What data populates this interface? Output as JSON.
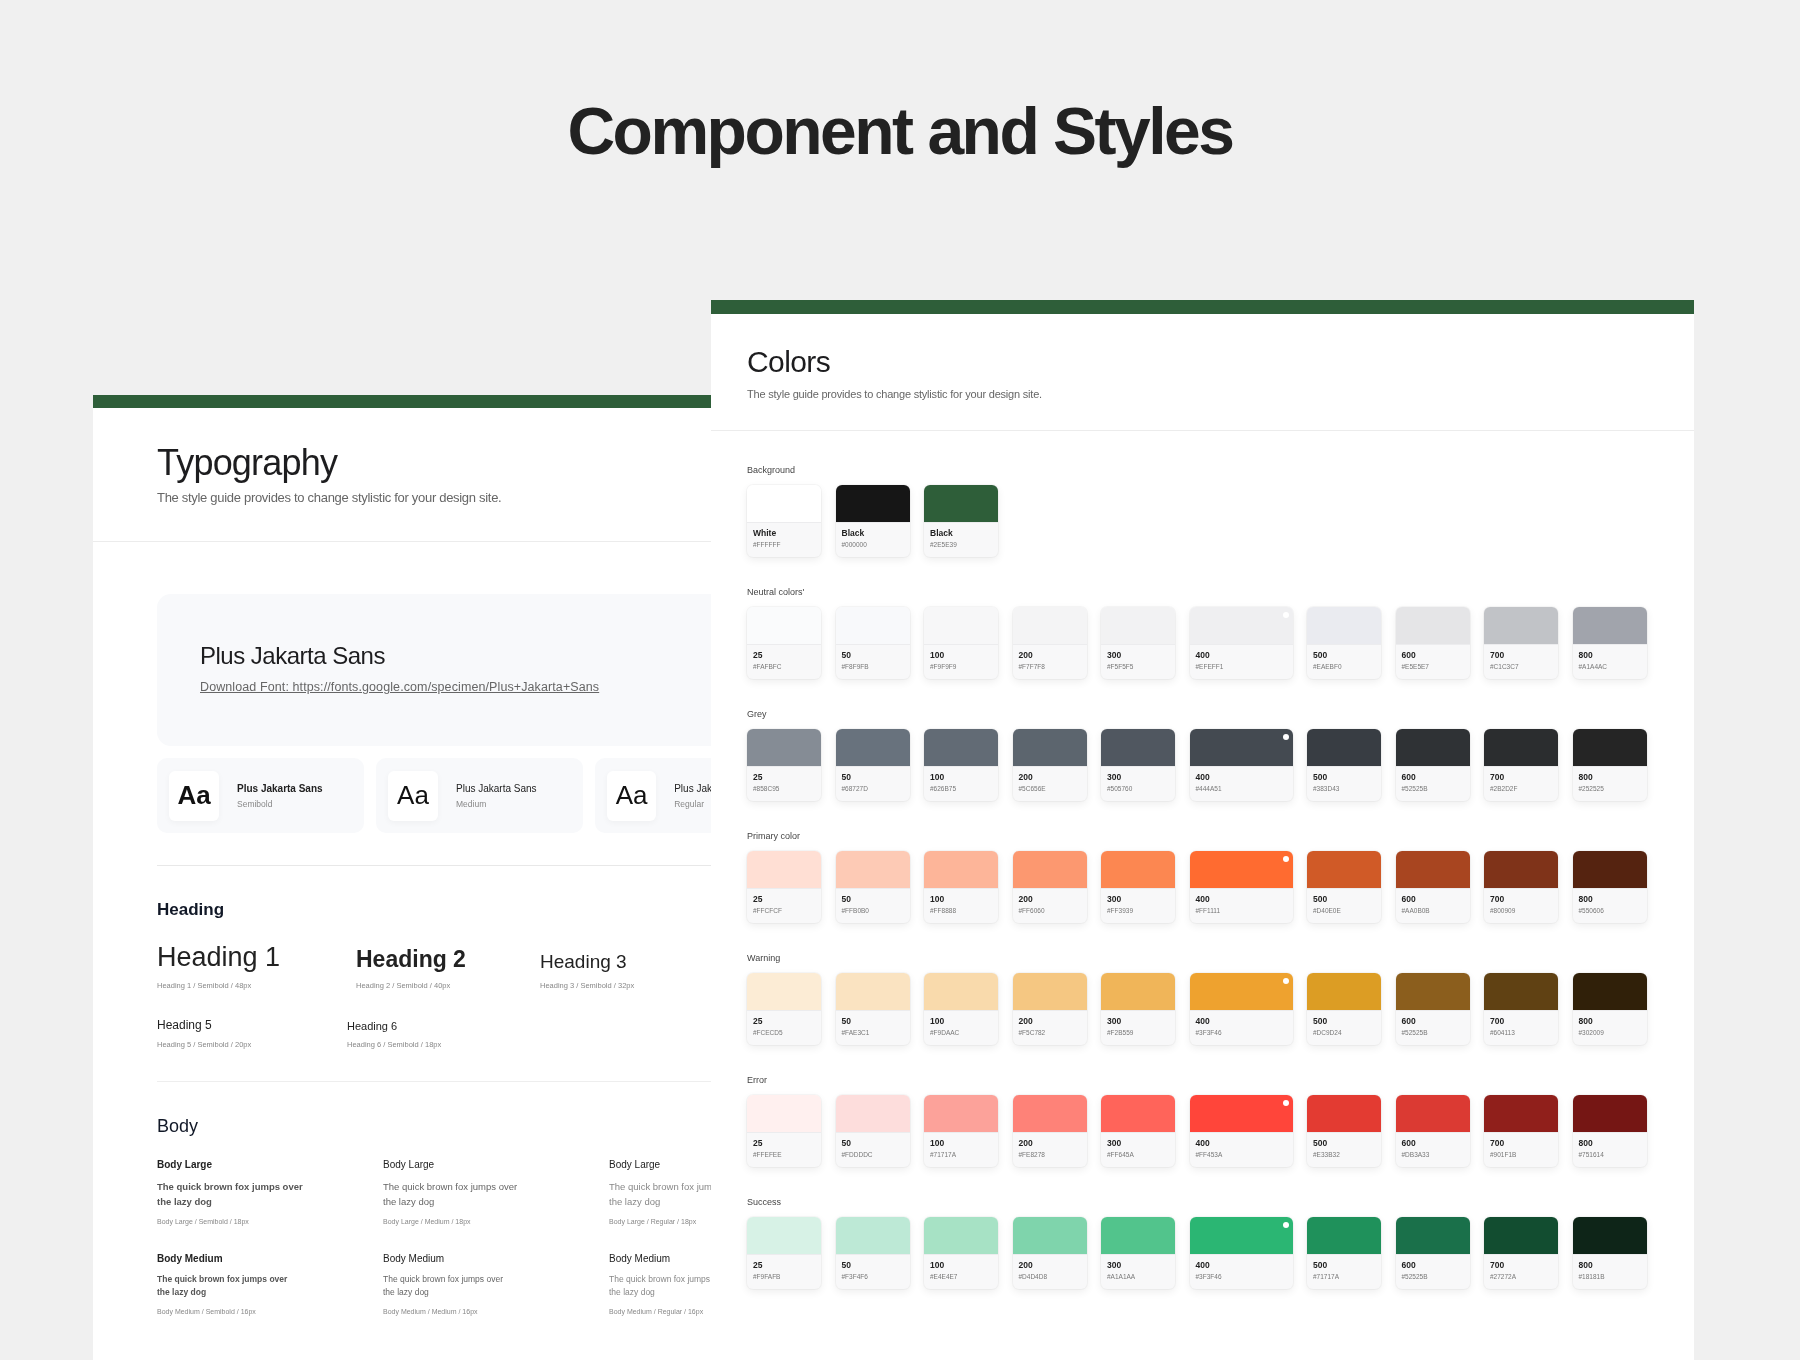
{
  "title": "Component and Styles",
  "typography": {
    "title": "Typography",
    "subtitle": "The style guide provides to change stylistic for your design site.",
    "font_card": {
      "name": "Plus Jakarta Sans",
      "link": "Download Font: https://fonts.google.com/specimen/Plus+Jakarta+Sans"
    },
    "weights": [
      {
        "sample": "Aa",
        "name": "Plus Jakarta Sans",
        "kind": "semibold",
        "caption": "Semibold"
      },
      {
        "sample": "Aa",
        "name": "Plus Jakarta Sans",
        "kind": "medium",
        "caption": "Medium"
      },
      {
        "sample": "Aa",
        "name": "Plus Jak",
        "kind": "regular",
        "caption": "Regular"
      }
    ],
    "headings": {
      "title": "Heading",
      "rows": [
        {
          "items": [
            {
              "kind": "h1",
              "text": "Heading 1",
              "caption": "Heading 1 / Semibold / 48px"
            },
            {
              "kind": "h2",
              "text": "Heading 2",
              "caption": "Heading 2 / Semibold / 40px"
            },
            {
              "kind": "h3",
              "text": "Heading 3",
              "caption": "Heading 3 / Semibold / 32px"
            }
          ]
        },
        {
          "items": [
            {
              "kind": "h5",
              "text": "Heading 5",
              "caption": "Heading 5 / Semibold / 20px"
            },
            {
              "kind": "h6",
              "text": "Heading 6",
              "caption": "Heading 6 / Semibold / 18px"
            }
          ]
        }
      ]
    },
    "body": {
      "title": "Body",
      "rows": [
        {
          "kind": "large",
          "items": [
            {
              "label": "Body Large",
              "kind": "semibold",
              "lines": [
                "The quick brown fox jumps over",
                "the lazy dog"
              ],
              "caption": "Body Large / Semibold / 18px"
            },
            {
              "label": "Body Large",
              "kind": "medium",
              "lines": [
                "The quick brown fox jumps over",
                "the lazy dog"
              ],
              "caption": "Body Large / Medium / 18px"
            },
            {
              "label": "Body Large",
              "kind": "regular",
              "lines": [
                "The quick brown fox jum",
                "the lazy dog"
              ],
              "caption": "Body Large / Regular / 18px"
            }
          ]
        },
        {
          "kind": "medium",
          "items": [
            {
              "label": "Body Medium",
              "kind": "semibold",
              "lines": [
                "The quick brown fox jumps over",
                "the lazy dog"
              ],
              "caption": "Body Medium / Semibold / 16px"
            },
            {
              "label": "Body Medium",
              "kind": "medium",
              "lines": [
                "The quick brown fox jumps over",
                "the lazy dog"
              ],
              "caption": "Body Medium / Medium / 16px"
            },
            {
              "label": "Body Medium",
              "kind": "regular",
              "lines": [
                "The quick brown fox jumps",
                "the lazy dog"
              ],
              "caption": "Body Medium / Regular / 16px"
            }
          ]
        }
      ]
    }
  },
  "colors": {
    "title": "Colors",
    "subtitle": "The style guide provides to change stylistic for your design site.",
    "groups": [
      {
        "label": "Background",
        "swatches": [
          {
            "label": "White",
            "hex": "#FFFFFF",
            "color": "#ffffff",
            "selected": false
          },
          {
            "label": "Black",
            "hex": "#000000",
            "color": "#161616",
            "selected": false
          },
          {
            "label": "Black",
            "hex": "#2E5E39",
            "color": "#2e5e39",
            "selected": false
          }
        ]
      },
      {
        "label": "Neutral colors'",
        "swatches": [
          {
            "label": "25",
            "hex": "#FAFBFC",
            "color": "#fafbfc",
            "selected": false
          },
          {
            "label": "50",
            "hex": "#F8F9FB",
            "color": "#f8f9fb",
            "selected": false
          },
          {
            "label": "100",
            "hex": "#F9F9F9",
            "color": "#f7f7f8",
            "selected": false
          },
          {
            "label": "200",
            "hex": "#F7F7F8",
            "color": "#f4f4f5",
            "selected": false
          },
          {
            "label": "300",
            "hex": "#F5F5F5",
            "color": "#f2f2f3",
            "selected": false
          },
          {
            "label": "400",
            "hex": "#EFEFF1",
            "color": "#efeff1",
            "selected": true
          },
          {
            "label": "500",
            "hex": "#EAEBF0",
            "color": "#eaebf0",
            "selected": false
          },
          {
            "label": "600",
            "hex": "#E5E5E7",
            "color": "#e5e5e7",
            "selected": false
          },
          {
            "label": "700",
            "hex": "#C1C3C7",
            "color": "#c1c3c7",
            "selected": false
          },
          {
            "label": "800",
            "hex": "#A1A4AC",
            "color": "#a1a4ac",
            "selected": false
          }
        ]
      },
      {
        "label": "Grey",
        "swatches": [
          {
            "label": "25",
            "hex": "#858C95",
            "color": "#858c95",
            "selected": false
          },
          {
            "label": "50",
            "hex": "#68727D",
            "color": "#68727d",
            "selected": false
          },
          {
            "label": "100",
            "hex": "#626B75",
            "color": "#626b75",
            "selected": false
          },
          {
            "label": "200",
            "hex": "#5C656E",
            "color": "#5c656e",
            "selected": false
          },
          {
            "label": "300",
            "hex": "#505760",
            "color": "#505760",
            "selected": false
          },
          {
            "label": "400",
            "hex": "#444A51",
            "color": "#444a51",
            "selected": true
          },
          {
            "label": "500",
            "hex": "#383D43",
            "color": "#383d43",
            "selected": false
          },
          {
            "label": "600",
            "hex": "#52525B",
            "color": "#2f3235",
            "selected": false
          },
          {
            "label": "700",
            "hex": "#2B2D2F",
            "color": "#2b2d2f",
            "selected": false
          },
          {
            "label": "800",
            "hex": "#252525",
            "color": "#252525",
            "selected": false
          }
        ]
      },
      {
        "label": "Primary color",
        "swatches": [
          {
            "label": "25",
            "hex": "#FFCFCF",
            "color": "#ffdfd4",
            "selected": false
          },
          {
            "label": "50",
            "hex": "#FFB0B0",
            "color": "#fdcab5",
            "selected": false
          },
          {
            "label": "100",
            "hex": "#FF8888",
            "color": "#fdb599",
            "selected": false
          },
          {
            "label": "200",
            "hex": "#FF6060",
            "color": "#fc9870",
            "selected": false
          },
          {
            "label": "300",
            "hex": "#FF3939",
            "color": "#fc8751",
            "selected": false
          },
          {
            "label": "400",
            "hex": "#FF1111",
            "color": "#ff6b30",
            "selected": true
          },
          {
            "label": "500",
            "hex": "#D40E0E",
            "color": "#d05a27",
            "selected": false
          },
          {
            "label": "600",
            "hex": "#AA0B0B",
            "color": "#a84520",
            "selected": false
          },
          {
            "label": "700",
            "hex": "#800909",
            "color": "#7f3319",
            "selected": false
          },
          {
            "label": "800",
            "hex": "#550606",
            "color": "#552310",
            "selected": false
          }
        ]
      },
      {
        "label": "Warning",
        "swatches": [
          {
            "label": "25",
            "hex": "#FCECD5",
            "color": "#fcecd5",
            "selected": false
          },
          {
            "label": "50",
            "hex": "#FAE3C1",
            "color": "#fae3c1",
            "selected": false
          },
          {
            "label": "100",
            "hex": "#F9DAAC",
            "color": "#f9daac",
            "selected": false
          },
          {
            "label": "200",
            "hex": "#F5C782",
            "color": "#f5c782",
            "selected": false
          },
          {
            "label": "300",
            "hex": "#F2B559",
            "color": "#f0b559",
            "selected": false
          },
          {
            "label": "400",
            "hex": "#3F3F46",
            "color": "#eea22f",
            "selected": true
          },
          {
            "label": "500",
            "hex": "#DC9D24",
            "color": "#dc9d24",
            "selected": false
          },
          {
            "label": "600",
            "hex": "#52525B",
            "color": "#8b5e1d",
            "selected": false
          },
          {
            "label": "700",
            "hex": "#604113",
            "color": "#604113",
            "selected": false
          },
          {
            "label": "800",
            "hex": "#302009",
            "color": "#302009",
            "selected": false
          }
        ]
      },
      {
        "label": "Error",
        "swatches": [
          {
            "label": "25",
            "hex": "#FFEFEE",
            "color": "#fff0ef",
            "selected": false
          },
          {
            "label": "50",
            "hex": "#FDDDDC",
            "color": "#fddddc",
            "selected": false
          },
          {
            "label": "100",
            "hex": "#71717A",
            "color": "#fca29a",
            "selected": false
          },
          {
            "label": "200",
            "hex": "#FE8278",
            "color": "#fe8278",
            "selected": false
          },
          {
            "label": "300",
            "hex": "#FF645A",
            "color": "#ff645a",
            "selected": false
          },
          {
            "label": "400",
            "hex": "#FF453A",
            "color": "#ff453a",
            "selected": true
          },
          {
            "label": "500",
            "hex": "#E33B32",
            "color": "#e33b32",
            "selected": false
          },
          {
            "label": "600",
            "hex": "#DB3A33",
            "color": "#db3a33",
            "selected": false
          },
          {
            "label": "700",
            "hex": "#901F1B",
            "color": "#901f1b",
            "selected": false
          },
          {
            "label": "800",
            "hex": "#751614",
            "color": "#751614",
            "selected": false
          }
        ]
      },
      {
        "label": "Success",
        "swatches": [
          {
            "label": "25",
            "hex": "#F9FAFB",
            "color": "#d7f2e6",
            "selected": false
          },
          {
            "label": "50",
            "hex": "#F3F4F6",
            "color": "#bde9d6",
            "selected": false
          },
          {
            "label": "100",
            "hex": "#E4E4E7",
            "color": "#a7e2c5",
            "selected": false
          },
          {
            "label": "200",
            "hex": "#D4D4D8",
            "color": "#7fd4ac",
            "selected": false
          },
          {
            "label": "300",
            "hex": "#A1A1AA",
            "color": "#52c48c",
            "selected": false
          },
          {
            "label": "400",
            "hex": "#3F3F46",
            "color": "#2bb673",
            "selected": true
          },
          {
            "label": "500",
            "hex": "#71717A",
            "color": "#1f915b",
            "selected": false
          },
          {
            "label": "600",
            "hex": "#52525B",
            "color": "#1a704a",
            "selected": false
          },
          {
            "label": "700",
            "hex": "#27272A",
            "color": "#124d30",
            "selected": false
          },
          {
            "label": "800",
            "hex": "#18181B",
            "color": "#0e2518",
            "selected": false
          }
        ]
      }
    ]
  }
}
